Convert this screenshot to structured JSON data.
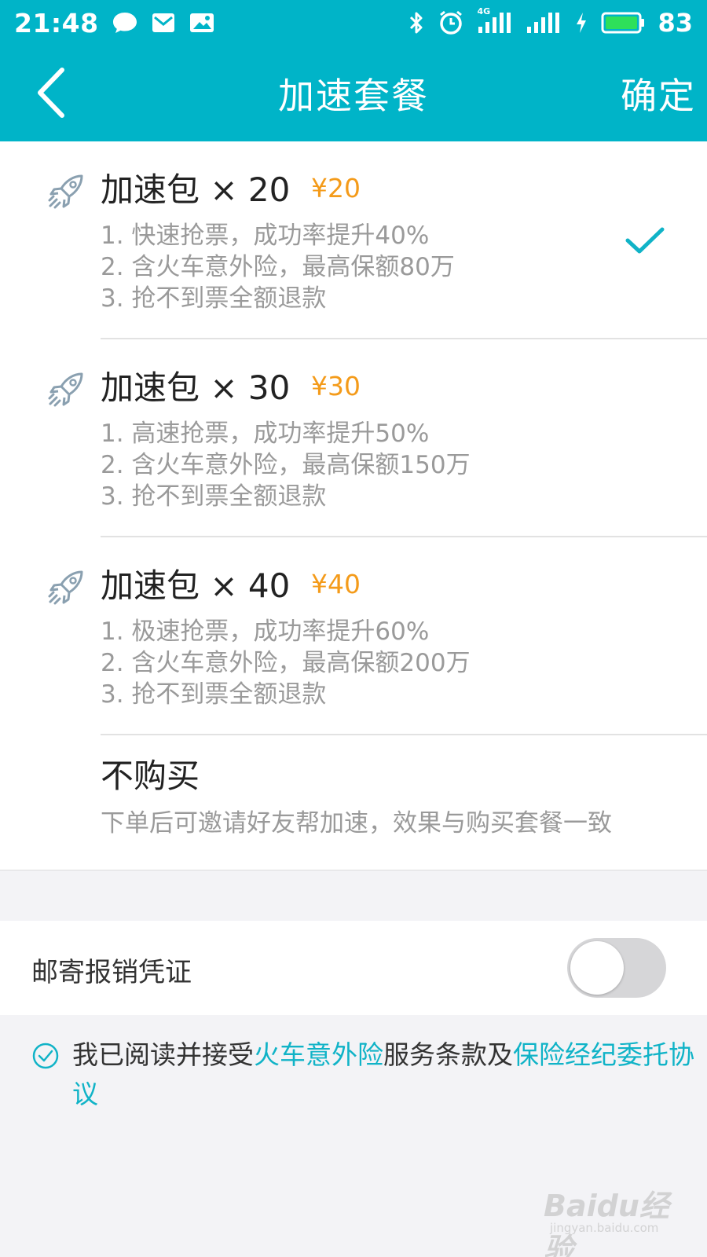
{
  "status_bar": {
    "time": "21:48",
    "network_label": "4G",
    "battery": "83",
    "icons": [
      "chat-icon",
      "mail-icon",
      "image-icon",
      "bluetooth-icon",
      "alarm-icon",
      "signal-4g-icon",
      "signal-icon",
      "charging-icon",
      "battery-icon"
    ]
  },
  "nav": {
    "title": "加速套餐",
    "confirm_label": "确定"
  },
  "packages": [
    {
      "name": "加速包 × 20",
      "price": "¥20",
      "selected": true,
      "features": [
        "1. 快速抢票，成功率提升40%",
        "2. 含火车意外险，最高保额80万",
        "3. 抢不到票全额退款"
      ]
    },
    {
      "name": "加速包 × 30",
      "price": "¥30",
      "selected": false,
      "features": [
        "1. 高速抢票，成功率提升50%",
        "2. 含火车意外险，最高保额150万",
        "3. 抢不到票全额退款"
      ]
    },
    {
      "name": "加速包 × 40",
      "price": "¥40",
      "selected": false,
      "features": [
        "1. 极速抢票，成功率提升60%",
        "2. 含火车意外险，最高保额200万",
        "3. 抢不到票全额退款"
      ]
    }
  ],
  "no_buy": {
    "title": "不购买",
    "description": "下单后可邀请好友帮加速，效果与购买套餐一致"
  },
  "receipt": {
    "label": "邮寄报销凭证",
    "toggle_on": false
  },
  "agreement": {
    "checked": true,
    "prefix": "我已阅读并接受",
    "link1": "火车意外险",
    "middle": "服务条款及",
    "link2": "保险经纪委托协议"
  },
  "watermark": {
    "brand": "Baidu经验",
    "url": "jingyan.baidu.com"
  },
  "colors": {
    "primary": "#00b4c8",
    "price": "#f49b1a",
    "link": "#10b3c7",
    "muted_text": "#9a9a9a",
    "background": "#f3f3f6"
  }
}
